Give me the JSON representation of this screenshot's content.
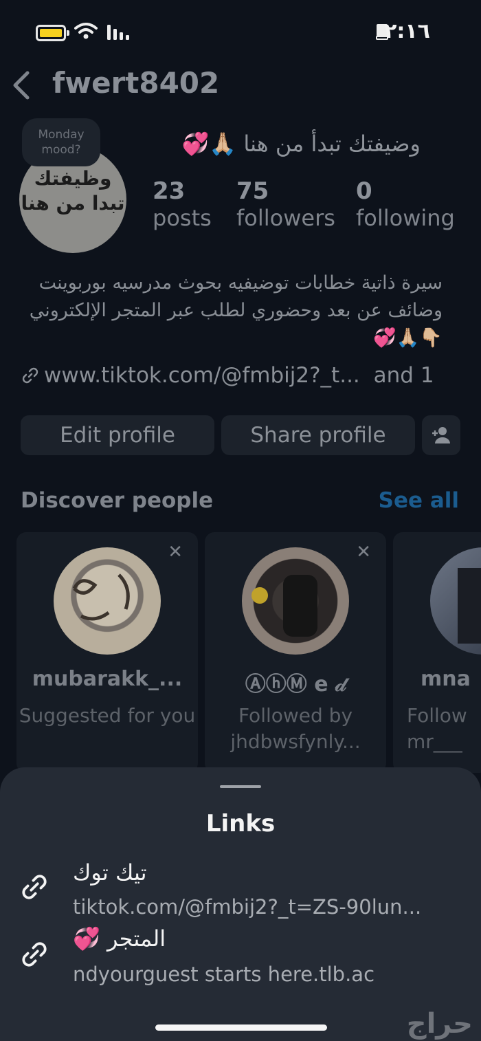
{
  "status_bar": {
    "time": "٢:١٦"
  },
  "header": {
    "username": "fwert8402"
  },
  "profile": {
    "note": "Monday mood?",
    "avatar_text": "وظيفتك تبدا من هنا",
    "display_name": "وضيفتك تبدأ من هنا 🙏🏼💞",
    "stats": [
      {
        "value": "23",
        "label": "posts"
      },
      {
        "value": "75",
        "label": "followers"
      },
      {
        "value": "0",
        "label": "following"
      }
    ],
    "bio": "سيرة ذاتية خطابات توضيفيه بحوث مدرسيه بوربوينت وضائف عن بعد وحضوري لطلب عبر المتجر الإلكتروني 👇🏼🙏🏼💞",
    "link": "www.tiktok.com/@fmbij2?_t...",
    "link_more": "and 1"
  },
  "buttons": {
    "edit": "Edit profile",
    "share": "Share profile"
  },
  "discover": {
    "title": "Discover people",
    "see_all": "See all",
    "cards": [
      {
        "name": "mubarakk_...",
        "sub": "Suggested for you"
      },
      {
        "name": "ⒶⓗⓂ e 𝒹",
        "sub": "Followed by jhdbwsfynly..."
      },
      {
        "name": "mna",
        "sub": "Follow mr___"
      }
    ]
  },
  "sheet": {
    "title": "Links",
    "links": [
      {
        "title": "تيك توك",
        "url": "tiktok.com/@fmbij2?_t=ZS-90lun..."
      },
      {
        "title": "المتجر 💞",
        "url": "ndyourguest starts here.tlb.ac"
      }
    ]
  },
  "watermark": "حراج"
}
